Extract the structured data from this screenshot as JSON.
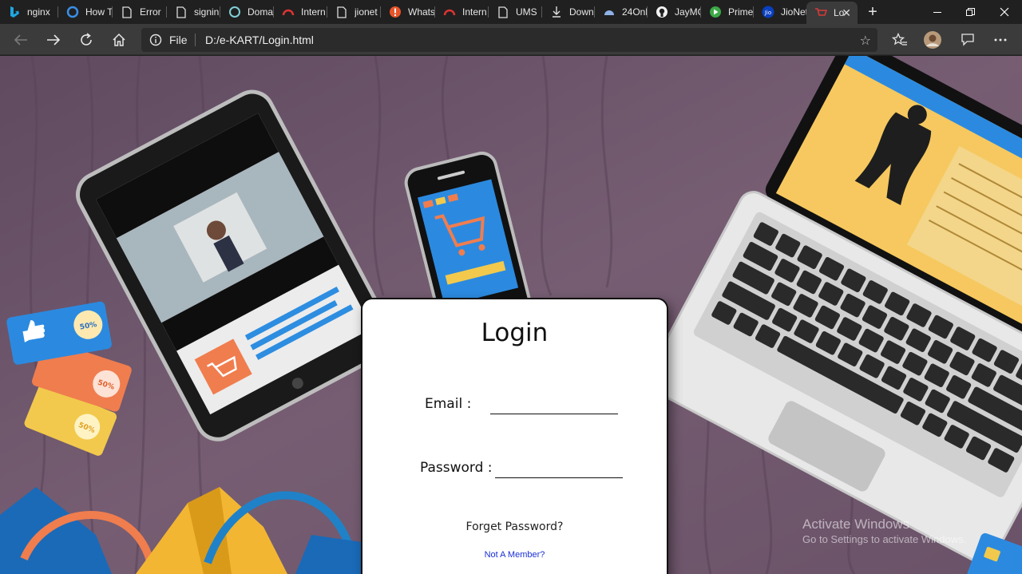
{
  "tabs": [
    {
      "label": "nginx",
      "icon": "bing-icon"
    },
    {
      "label": "How T",
      "icon": "edge-refresh-icon"
    },
    {
      "label": "Error",
      "icon": "page-icon"
    },
    {
      "label": "signin",
      "icon": "page-icon"
    },
    {
      "label": "Doma",
      "icon": "domain-icon"
    },
    {
      "label": "Intern",
      "icon": "gauge-icon"
    },
    {
      "label": "jionet",
      "icon": "page-icon"
    },
    {
      "label": "Whats",
      "icon": "alert-icon"
    },
    {
      "label": "Intern",
      "icon": "gauge-icon"
    },
    {
      "label": "UMS",
      "icon": "page-icon"
    },
    {
      "label": "Down",
      "icon": "download-icon"
    },
    {
      "label": "24Onl",
      "icon": "cloud-icon"
    },
    {
      "label": "JayMC",
      "icon": "github-icon"
    },
    {
      "label": "Prime",
      "icon": "play-icon"
    },
    {
      "label": "JioNet",
      "icon": "jio-icon"
    },
    {
      "label": "Lo",
      "icon": "cart-icon",
      "active": true
    }
  ],
  "address_bar": {
    "protocol_label": "File",
    "url": "D:/e-KART/Login.html"
  },
  "login": {
    "title": "Login",
    "email_label": "Email :",
    "email_value": "",
    "password_label": "Password :",
    "password_value": "",
    "forgot_link": "Forget Password?",
    "member_link": "Not A Member?"
  },
  "background_badges": [
    "50%",
    "50%",
    "50%"
  ],
  "watermark": {
    "title": "Activate Windows",
    "subtitle": "Go to Settings to activate Windows."
  },
  "colors": {
    "page_background": "#6d5569",
    "link_blue": "#1a2fd6",
    "browser_chrome": "#202020",
    "toolbar": "#3b3b3b"
  }
}
